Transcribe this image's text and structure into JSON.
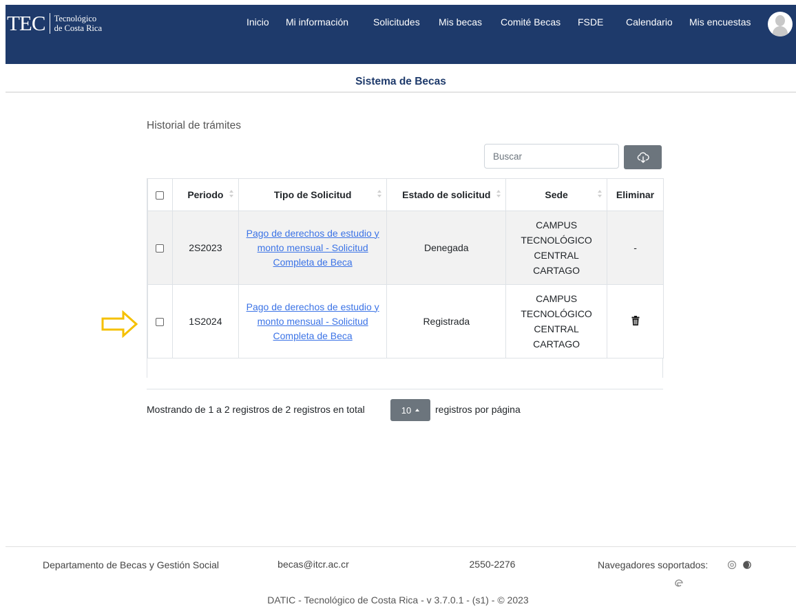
{
  "header": {
    "logo": {
      "acronym": "TEC",
      "line1": "Tecnológico",
      "line2": "de Costa Rica"
    },
    "nav": [
      "Inicio",
      "Mi información",
      "Solicitudes",
      "Mis becas",
      "Comité Becas",
      "FSDE",
      "Calendario",
      "Mis encuestas"
    ]
  },
  "subtitle": "Sistema de Becas",
  "section_title": "Historial de trámites",
  "search": {
    "placeholder": "Buscar"
  },
  "table": {
    "columns": [
      "Periodo",
      "Tipo de Solicitud",
      "Estado de solicitud",
      "Sede",
      "Eliminar"
    ],
    "rows": [
      {
        "periodo": "2S2023",
        "tipo": "Pago de derechos de estudio y monto mensual - Solicitud Completa de Beca",
        "estado": "Denegada",
        "sede": [
          "CAMPUS",
          "TECNOLÓGICO",
          "CENTRAL",
          "CARTAGO"
        ],
        "eliminar": "-"
      },
      {
        "periodo": "1S2024",
        "tipo": "Pago de derechos de estudio y monto mensual - Solicitud Completa de Beca",
        "estado": "Registrada",
        "sede": [
          "CAMPUS",
          "TECNOLÓGICO",
          "CENTRAL",
          "CARTAGO"
        ],
        "eliminar": "trash-icon"
      }
    ]
  },
  "pagination": {
    "showing": "Mostrando de 1 a 2 registros de 2 registros en total",
    "page_size": "10",
    "per_page_label": "registros por página"
  },
  "footer": {
    "dept": "Departamento de Becas y Gestión Social",
    "email": "becas@itcr.ac.cr",
    "phone": "2550-2276",
    "browsers_label": "Navegadores soportados:",
    "copyright": "DATIC - Tecnológico de Costa Rica - v 3.7.0.1 - (s1) - © 2023"
  },
  "colors": {
    "header_bg": "#1e3a6b",
    "link": "#3b73e6",
    "arrow": "#f5c000",
    "button": "#6c757d"
  }
}
